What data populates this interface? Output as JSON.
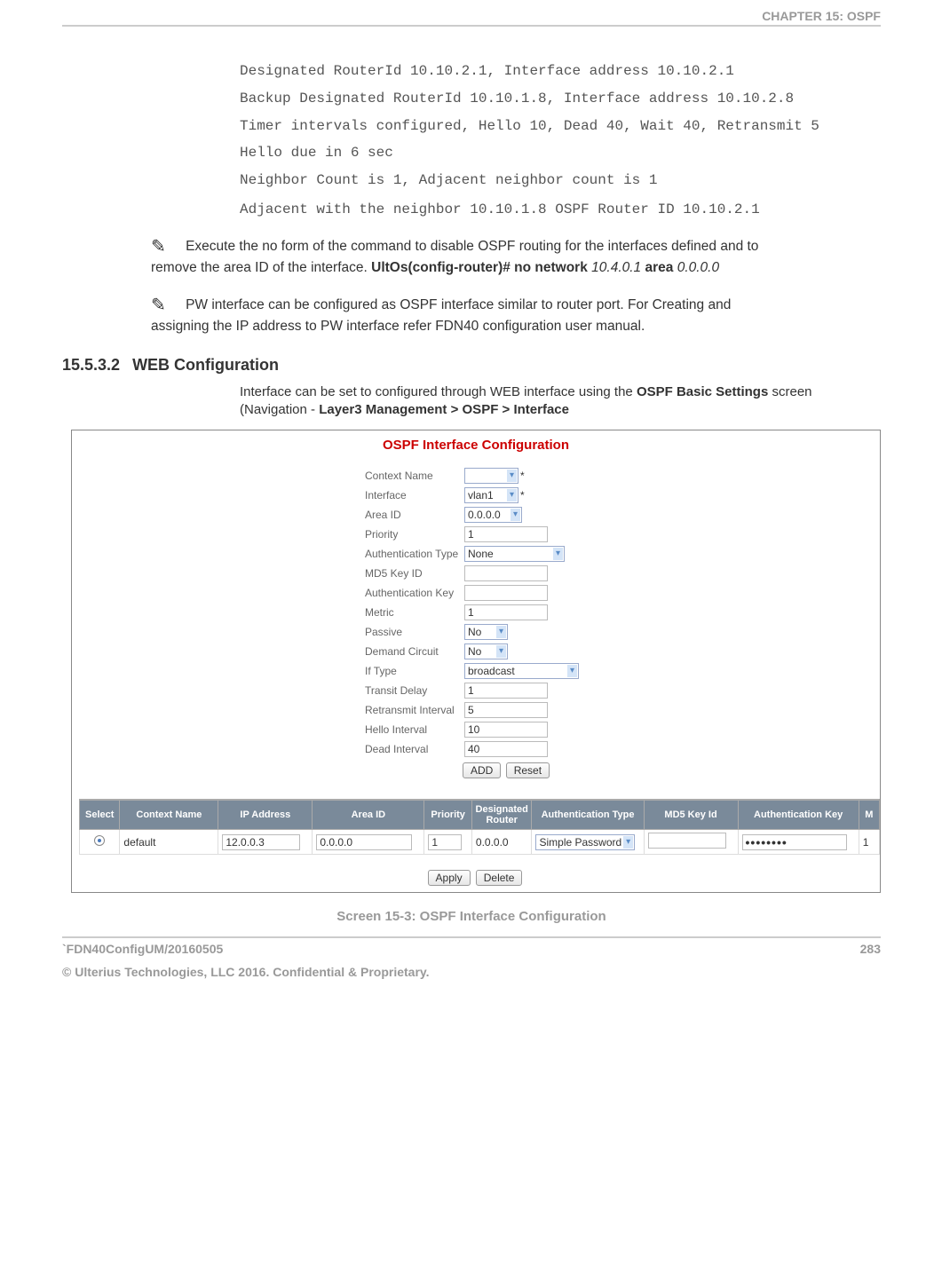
{
  "header": {
    "chapter": "CHAPTER 15: OSPF"
  },
  "mono": {
    "l1": "Designated RouterId 10.10.2.1, Interface address 10.10.2.1",
    "l2": "Backup Designated RouterId 10.10.1.8, Interface address 10.10.2.8",
    "l3": "Timer intervals configured, Hello 10, Dead 40, Wait 40, Retransmit 5",
    "l4": "Hello due in 6 sec",
    "l5": "Neighbor Count is 1, Adjacent neighbor count is 1",
    "l6": "Adjacent with the neighbor 10.10.1.8 OSPF Router ID 10.10.2.1"
  },
  "note1": {
    "t1": "Execute the no form of the command to disable OSPF routing for the interfaces defined and to remove the area ID of the interface. ",
    "b1": "UltOs(config-router)# no network",
    "i1": " 10.4.0.1 ",
    "b2": "area",
    "i2": " 0.0.0.0"
  },
  "note2": {
    "t1": "PW interface can be configured as OSPF interface similar to router port. For Creating and assigning the IP address to PW interface refer FDN40 configuration user manual."
  },
  "section": {
    "num": "15.5.3.2",
    "title": "WEB Configuration"
  },
  "body": {
    "t1": "Interface can be set to configured through WEB interface using the ",
    "b1": "OSPF Basic Settings",
    "t2": " screen (Navigation - ",
    "b2": "Layer3 Management > OSPF > Interface"
  },
  "screenshot": {
    "title": "OSPF Interface Configuration",
    "labels": {
      "context": "Context Name",
      "interface": "Interface",
      "area": "Area ID",
      "priority": "Priority",
      "authtype": "Authentication Type",
      "md5": "MD5 Key ID",
      "authkey": "Authentication Key",
      "metric": "Metric",
      "passive": "Passive",
      "demand": "Demand Circuit",
      "iftype": "If Type",
      "transit": "Transit Delay",
      "retransmit": "Retransmit Interval",
      "hello": "Hello Interval",
      "dead": "Dead Interval"
    },
    "values": {
      "interface": "vlan1",
      "area": "0.0.0.0",
      "priority": "1",
      "authtype": "None",
      "metric": "1",
      "passive": "No",
      "demand": "No",
      "iftype": "broadcast",
      "transit": "1",
      "retransmit": "5",
      "hello": "10",
      "dead": "40"
    },
    "buttons": {
      "add": "ADD",
      "reset": "Reset",
      "apply": "Apply",
      "delete": "Delete"
    },
    "table": {
      "headers": [
        "Select",
        "Context Name",
        "IP Address",
        "Area ID",
        "Priority",
        "Designated Router",
        "Authentication Type",
        "MD5 Key Id",
        "Authentication Key",
        "M"
      ],
      "row": {
        "context": "default",
        "ip": "12.0.0.3",
        "area": "0.0.0.0",
        "priority": "1",
        "dr": "0.0.0.0",
        "authtype": "Simple Password",
        "md5": "",
        "authkey": "••••••••",
        "m": "1"
      }
    }
  },
  "caption": "Screen 15-3: OSPF Interface Configuration",
  "footer": {
    "left": "`FDN40ConfigUM/20160505",
    "right": "283",
    "sub": "© Ulterius Technologies, LLC 2016. Confidential & Proprietary."
  }
}
